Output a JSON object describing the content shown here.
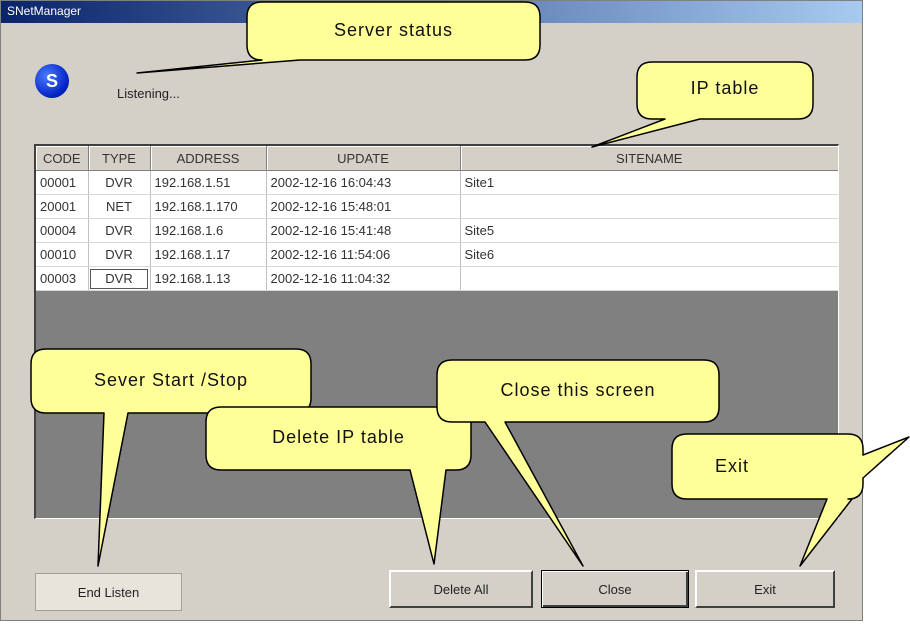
{
  "window": {
    "title": "SNetManager"
  },
  "status": {
    "icon": "server-status-icon",
    "icon_letter": "S",
    "text": "Listening..."
  },
  "table": {
    "columns": [
      "CODE",
      "TYPE",
      "ADDRESS",
      "UPDATE",
      "SITENAME"
    ],
    "rows": [
      [
        "00001",
        "DVR",
        "192.168.1.51",
        "2002-12-16 16:04:43",
        "Site1"
      ],
      [
        "20001",
        "NET",
        "192.168.1.170",
        "2002-12-16 15:48:01",
        ""
      ],
      [
        "00004",
        "DVR",
        "192.168.1.6",
        "2002-12-16 15:41:48",
        "Site5"
      ],
      [
        "00010",
        "DVR",
        "192.168.1.17",
        "2002-12-16 11:54:06",
        "Site6"
      ],
      [
        "00003",
        "DVR",
        "192.168.1.13",
        "2002-12-16 11:04:32",
        ""
      ]
    ]
  },
  "buttons": {
    "end_listen": "End Listen",
    "delete_all": "Delete All",
    "close": "Close",
    "exit": "Exit"
  },
  "callouts": {
    "server_status": "Server status",
    "ip_table": "IP table",
    "sever_start_stop": "Sever Start /Stop",
    "delete_ip_table": "Delete IP table",
    "close_screen": "Close this screen",
    "exit": "Exit"
  },
  "colors": {
    "callout_fill": "#ffff99",
    "window_bg": "#d4d0c8",
    "grid_empty": "#808080",
    "title_bar": "#0a246a"
  }
}
